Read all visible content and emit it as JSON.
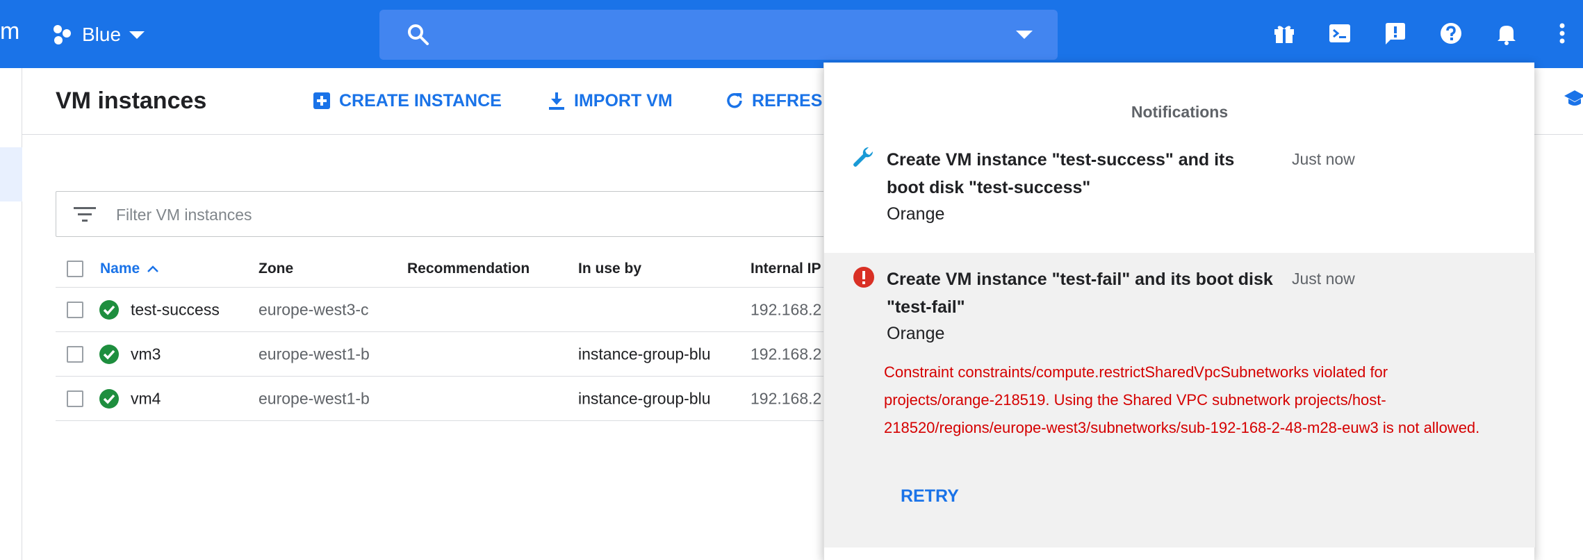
{
  "topbar": {
    "brand_fragment": "m",
    "project_name": "Blue",
    "search_placeholder": "",
    "icons": [
      "gift-icon",
      "cloud-shell-icon",
      "feedback-icon",
      "help-icon",
      "notifications-bell-icon",
      "more-vert-icon"
    ]
  },
  "actionbar": {
    "title": "VM instances",
    "create_label": "CREATE INSTANCE",
    "import_label": "IMPORT VM",
    "refresh_label": "REFRESH",
    "learn_label": "L"
  },
  "filter": {
    "placeholder": "Filter VM instances"
  },
  "table": {
    "columns": [
      "Name",
      "Zone",
      "Recommendation",
      "In use by",
      "Internal IP"
    ],
    "rows": [
      {
        "name": "test-success",
        "zone": "europe-west3-c",
        "recommendation": "",
        "in_use_by": "",
        "internal_ip": "192.168.2",
        "status": "running"
      },
      {
        "name": "vm3",
        "zone": "europe-west1-b",
        "recommendation": "",
        "in_use_by": "instance-group-blu",
        "internal_ip": "192.168.2",
        "status": "running"
      },
      {
        "name": "vm4",
        "zone": "europe-west1-b",
        "recommendation": "",
        "in_use_by": "instance-group-blu",
        "internal_ip": "192.168.2",
        "status": "running"
      }
    ]
  },
  "notifications": {
    "title": "Notifications",
    "items": [
      {
        "title": "Create VM instance \"test-success\" and its boot disk \"test-success\"",
        "project": "Orange",
        "time": "Just now",
        "icon": "wrench-icon"
      },
      {
        "title": "Create VM instance \"test-fail\" and its boot disk \"test-fail\"",
        "project": "Orange",
        "time": "Just now",
        "icon": "error-icon",
        "error": "Constraint constraints/compute.restrictSharedVpcSubnetworks violated for projects/orange-218519. Using the Shared VPC subnetwork projects/host-218520/regions/europe-west3/subnetworks/sub-192-168-2-48-m28-euw3 is not allowed.",
        "action": "RETRY"
      }
    ]
  },
  "colors": {
    "brand_blue": "#1a73e8",
    "search_blue": "#4285f0",
    "success_green": "#1e8e3e",
    "error_red": "#d50000",
    "wrench_teal": "#1a9ad6"
  }
}
